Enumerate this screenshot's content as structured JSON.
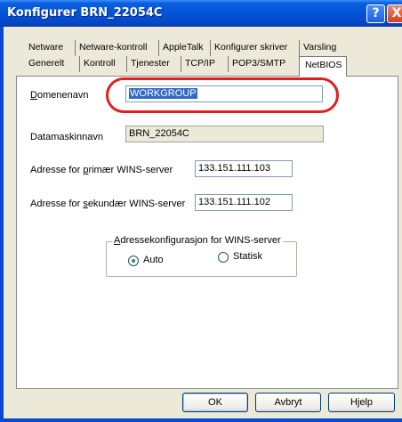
{
  "window": {
    "title": "Konfigurer BRN_22054C",
    "help_glyph": "?",
    "close_glyph": "X"
  },
  "tabs_row1": [
    {
      "label": "Netware"
    },
    {
      "label": "Netware-kontroll"
    },
    {
      "label": "AppleTalk"
    },
    {
      "label": "Konfigurer skriver"
    },
    {
      "label": "Varsling"
    }
  ],
  "tabs_row2": [
    {
      "label": "Generelt"
    },
    {
      "label": "Kontroll"
    },
    {
      "label": "Tjenester"
    },
    {
      "label": "TCP/IP"
    },
    {
      "label": "POP3/SMTP"
    },
    {
      "label": "NetBIOS",
      "active": true
    }
  ],
  "form": {
    "domain_label_accel": "D",
    "domain_label_rest": "omenenavn",
    "domain_value": "WORKGROUP",
    "computer_label": "Datamaskinnavn",
    "computer_value": "BRN_22054C",
    "wins_primary_label_a": "Adresse for ",
    "wins_primary_label_accel": "p",
    "wins_primary_label_b": "rimær WINS-server",
    "wins_primary_value": "133.151.111.103",
    "wins_secondary_label_a": "Adresse for ",
    "wins_secondary_label_accel": "s",
    "wins_secondary_label_b": "ekundær WINS-server",
    "wins_secondary_value": "133.151.111.102"
  },
  "wins_config": {
    "legend": "Adressekonfigurasjon for WINS-server",
    "legend_accel": "A",
    "legend_rest": "dressekonfigurasjon for WINS-server",
    "options": [
      {
        "label": "Auto",
        "selected": true
      },
      {
        "label": "Statisk",
        "selected": false
      }
    ]
  },
  "buttons": {
    "ok": "OK",
    "cancel": "Avbryt",
    "help": "Hjelp"
  },
  "colors": {
    "title_bar": "#0453d8",
    "highlight_oval": "#e02020",
    "selection": "#316ac5",
    "dialog_bg": "#ece9d8"
  }
}
